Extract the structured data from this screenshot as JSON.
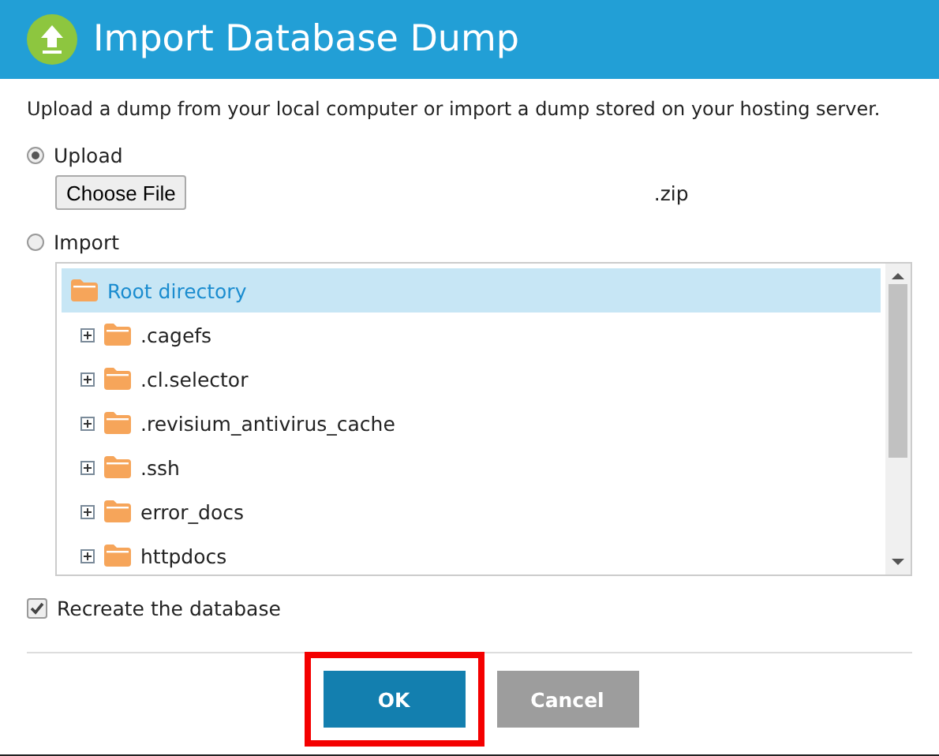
{
  "window": {
    "title": "Import Database Dump"
  },
  "description": "Upload a dump from your local computer or import a dump stored on your hosting server.",
  "source_options": [
    {
      "label": "Upload",
      "selected": true
    },
    {
      "label": "Import",
      "selected": false
    }
  ],
  "file_input": {
    "button": "Choose File",
    "suffix": ".zip"
  },
  "folder_tree": {
    "root": {
      "label": "Root directory",
      "selected": true,
      "children": [
        {
          "label": ".cagefs",
          "expanded": false,
          "selected": false
        },
        {
          "label": ".cl.selector",
          "expanded": false,
          "selected": false
        },
        {
          "label": ".revisium_antivirus_cache",
          "expanded": false,
          "selected": false
        },
        {
          "label": ".ssh",
          "expanded": false,
          "selected": false
        },
        {
          "label": "error_docs",
          "expanded": false,
          "selected": false
        },
        {
          "label": "httpdocs",
          "expanded": false,
          "selected": false
        }
      ]
    }
  },
  "recreate_database": {
    "label": "Recreate the database",
    "checked": true
  },
  "buttons": [
    {
      "label": "OK",
      "kind": "primary",
      "highlighted": true
    },
    {
      "label": "Cancel",
      "kind": "secondary",
      "highlighted": false
    }
  ]
}
